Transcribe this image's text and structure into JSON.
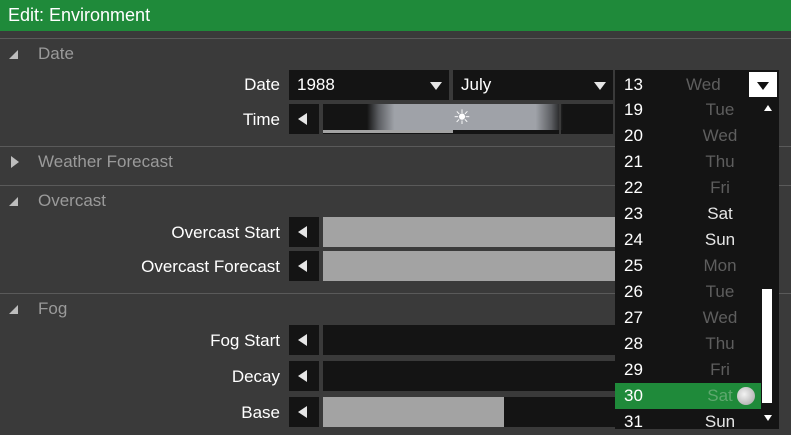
{
  "title": "Edit: Environment",
  "sections": {
    "date": "Date",
    "weather": "Weather Forecast",
    "overcast": "Overcast",
    "fog": "Fog"
  },
  "date_row": {
    "label": "Date",
    "year": "1988",
    "month": "July",
    "day_num": "13",
    "day_name": "Wed"
  },
  "time_row": {
    "label": "Time"
  },
  "overcast_rows": {
    "start_label": "Overcast Start",
    "forecast_label": "Overcast Forecast"
  },
  "fog_rows": {
    "start_label": "Fog Start",
    "decay_label": "Decay",
    "base_label": "Base",
    "base_fill": 0.62
  },
  "day_list": [
    {
      "num": "19",
      "day": "Tue",
      "dim": true
    },
    {
      "num": "20",
      "day": "Wed",
      "dim": true
    },
    {
      "num": "21",
      "day": "Thu",
      "dim": true
    },
    {
      "num": "22",
      "day": "Fri",
      "dim": true
    },
    {
      "num": "23",
      "day": "Sat",
      "dim": false
    },
    {
      "num": "24",
      "day": "Sun",
      "dim": false
    },
    {
      "num": "25",
      "day": "Mon",
      "dim": true
    },
    {
      "num": "26",
      "day": "Tue",
      "dim": true
    },
    {
      "num": "27",
      "day": "Wed",
      "dim": true
    },
    {
      "num": "28",
      "day": "Thu",
      "dim": true
    },
    {
      "num": "29",
      "day": "Fri",
      "dim": true
    },
    {
      "num": "30",
      "day": "Sat",
      "dim": true,
      "selected": true
    },
    {
      "num": "31",
      "day": "Sun",
      "dim": false
    }
  ],
  "colors": {
    "accent": "#1f8a3a",
    "dim_text": "#5e5e5e",
    "bright_text": "#e6e6e6"
  },
  "icons": {
    "sun": "sun-icon",
    "moon": "moon-icon"
  }
}
